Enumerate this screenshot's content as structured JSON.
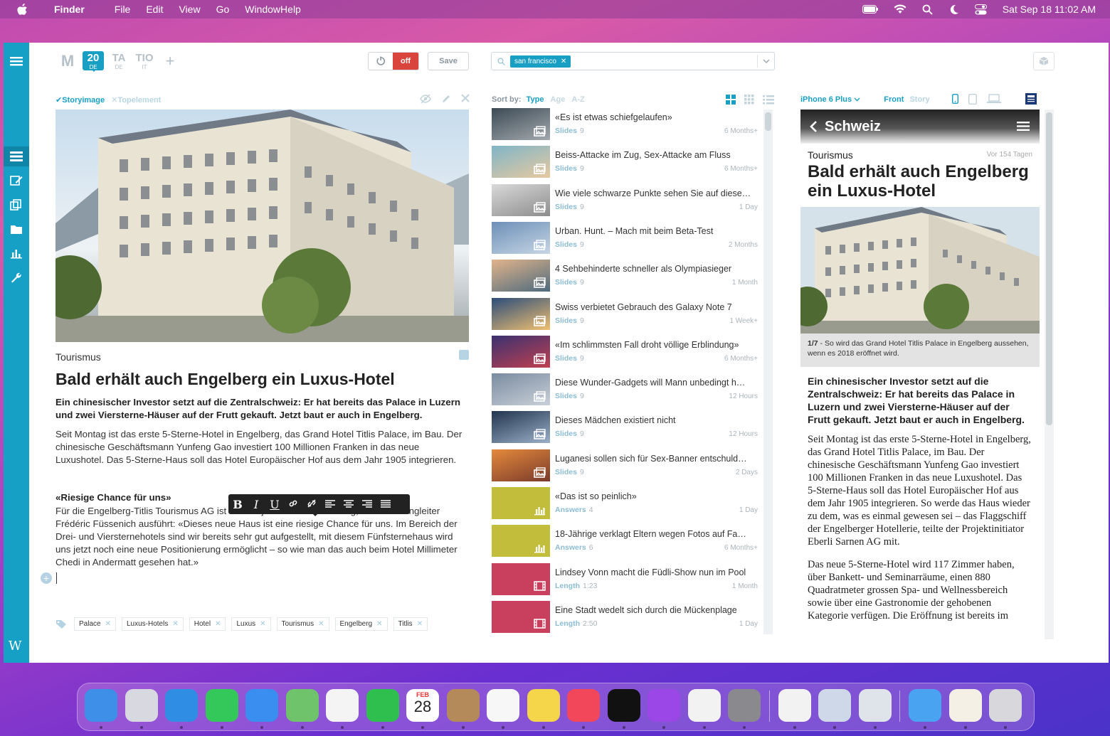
{
  "menubar": {
    "app": "Finder",
    "items": [
      "File",
      "Edit",
      "View",
      "Go",
      "WindowHelp"
    ],
    "clock": "Sat Sep 18  11:02 AM"
  },
  "toolbar": {
    "tabs": [
      {
        "top": "M",
        "bottom": ""
      },
      {
        "top": "20",
        "bottom": "DE"
      },
      {
        "top": "TA",
        "bottom": "DE"
      },
      {
        "top": "TIO",
        "bottom": "IT"
      },
      {
        "top": "+",
        "bottom": ""
      }
    ],
    "toggle_label": "off",
    "save_label": "Save",
    "search_chip": "san francisco"
  },
  "editor": {
    "tab_active": "Storyimage",
    "tab_inactive": "Topelement",
    "kicker": "Tourismus",
    "headline": "Bald erhält auch Engelberg ein Luxus-Hotel",
    "lead": "Ein chinesischer Investor setzt auf die Zentralschweiz: Er hat bereits das Palace in Luzern und zwei Viersterne-Häuser auf der Frutt gekauft. Jetzt baut er auch in Engelberg.",
    "body1": "Seit Montag ist das erste 5-Sterne-Hotel in Engelberg, das Grand Hotel Titlis Palace, im Bau. Der chinesische Geschäftsmann Yunfeng Gao investiert 100 Millionen Franken in das neue Luxushotel. Das 5-Sterne-Haus soll das Hotel Europäischer Hof aus dem Jahr 1905 integrieren.",
    "subhead": "«Riesige Chance für uns»",
    "body2": "Für die Engelberg-Titlis Tourismus AG ist das Projekt eine Bereicherung, wie Marketingleiter Frédéric Füssenich ausführt: «Dieses neue Haus ist eine riesige Chance für uns. Im Bereich der Drei- und Viersternehotels sind wir bereits sehr gut aufgestellt, mit diesem Fünfsternehaus wird uns jetzt noch eine neue Positionierung ermöglicht – so wie man das auch beim Hotel Millimeter Chedi in Andermatt gesehen hat.»",
    "format": {
      "bold": "B",
      "italic": "I",
      "underline": "U"
    },
    "tags": [
      "Palace",
      "Luxus-Hotels",
      "Hotel",
      "Luxus",
      "Tourismus",
      "Engelberg",
      "Titlis"
    ]
  },
  "list": {
    "sort_label": "Sort by:",
    "sort_options": [
      "Type",
      "Age",
      "A-Z"
    ],
    "items": [
      {
        "title": "«Es ist etwas schiefgelaufen»",
        "type": "Slides",
        "count": "9",
        "age": "6 Months+",
        "kind": "photo",
        "c1": "#3c4a55",
        "c2": "#a3a9ad"
      },
      {
        "title": "Beiss-Attacke im Zug, Sex-Attacke am Fluss",
        "type": "Slides",
        "count": "9",
        "age": "6 Months+",
        "kind": "photo",
        "c1": "#7fb5c8",
        "c2": "#e7c9a0"
      },
      {
        "title": "Wie viele schwarze Punkte sehen Sie auf diese…",
        "type": "Slides",
        "count": "9",
        "age": "1 Day",
        "kind": "photo",
        "c1": "#d9d9d9",
        "c2": "#8d8d8d"
      },
      {
        "title": "Urban. Hunt. – Mach mit beim Beta-Test",
        "type": "Slides",
        "count": "9",
        "age": "2 Months",
        "kind": "photo",
        "c1": "#6d8fb8",
        "c2": "#c6d6e4"
      },
      {
        "title": "4 Sehbehinderte schneller als Olympiasieger",
        "type": "Slides",
        "count": "9",
        "age": "1 Month",
        "kind": "photo",
        "c1": "#e2b48a",
        "c2": "#4d6a7e"
      },
      {
        "title": "Swiss verbietet Gebrauch des Galaxy Note 7",
        "type": "Slides",
        "count": "9",
        "age": "1 Week+",
        "kind": "photo",
        "c1": "#2b4c7a",
        "c2": "#f0c070"
      },
      {
        "title": "«Im schlimmsten Fall droht völlige Erblindung»",
        "type": "Slides",
        "count": "9",
        "age": "6 Months+",
        "kind": "photo",
        "c1": "#3a3170",
        "c2": "#c04050"
      },
      {
        "title": "Diese Wunder-Gadgets will Mann unbedingt h…",
        "type": "Slides",
        "count": "9",
        "age": "12 Hours",
        "kind": "photo",
        "c1": "#7a8ba0",
        "c2": "#c9d0d8"
      },
      {
        "title": "Dieses Mädchen existiert nicht",
        "type": "Slides",
        "count": "9",
        "age": "12 Hours",
        "kind": "photo",
        "c1": "#22344e",
        "c2": "#9bb0c8"
      },
      {
        "title": "Luganesi sollen sich für Sex-Banner entschuld…",
        "type": "Slides",
        "count": "9",
        "age": "2 Days",
        "kind": "photo",
        "c1": "#e58a3c",
        "c2": "#7a3a2a"
      },
      {
        "title": "«Das ist so peinlich»",
        "type": "Answers",
        "count": "4",
        "age": "1 Day",
        "kind": "chart",
        "c1": "#c3bd3c",
        "c2": "#c3bd3c"
      },
      {
        "title": "18-Jährige verklagt Eltern wegen Fotos auf Fa…",
        "type": "Answers",
        "count": "6",
        "age": "6 Months+",
        "kind": "chart",
        "c1": "#c3bd3c",
        "c2": "#c3bd3c"
      },
      {
        "title": "Lindsey Vonn macht die Füdli-Show nun im Pool",
        "type": "Length",
        "count": "1:23",
        "age": "1 Month",
        "kind": "video",
        "c1": "#c8405e",
        "c2": "#c8405e"
      },
      {
        "title": "Eine Stadt wedelt sich durch die Mückenplage",
        "type": "Length",
        "count": "2:50",
        "age": "1 Day",
        "kind": "video",
        "c1": "#c8405e",
        "c2": "#c8405e"
      }
    ]
  },
  "preview": {
    "device": "iPhone 6 Plus",
    "view_active": "Front",
    "view_inactive": "Story",
    "section": "Schweiz",
    "kicker": "Tourismus",
    "age": "Vor 154 Tagen",
    "title": "Bald erhält auch Engelberg ein Luxus-Hotel",
    "caption_num": "1/7",
    "caption": " - So wird das Grand Hotel Titlis Palace in Engelberg aussehen, wenn es 2018 eröffnet wird.",
    "lead": "Ein chinesischer Investor setzt auf die Zentralschweiz: Er hat bereits das Palace in Luzern und zwei Viersterne-Häuser auf der Frutt gekauft. Jetzt baut er auch in Engelberg.",
    "body1": "Seit Montag ist das erste 5-Sterne-Hotel in Engelberg, das Grand Hotel Titlis Palace, im Bau. Der chinesische Geschäftsmann Yunfeng Gao investiert 100 Millionen Franken in das neue Luxushotel. Das 5-Sterne-Haus soll das Hotel Europäischer Hof aus dem Jahr 1905 integrieren. So werde das Haus wieder zu dem, was es einmal gewesen sei – das Flaggschiff der Engelberger Hotellerie, teilte der Projektinitiator Eberli Sarnen AG mit.",
    "body2": "Das neue 5-Sterne-Hotel wird 117 Zimmer haben, über Bankett- und Seminarräume, einen 880 Quadratmeter grossen Spa- und Wellnessbereich sowie über eine Gastronomie der gehobenen Kategorie verfügen. Die Eröffnung ist bereits im"
  },
  "dock": {
    "calendar_month": "FEB",
    "calendar_day": "28",
    "apps": [
      {
        "name": "finder",
        "color": "#3d8fe8"
      },
      {
        "name": "launchpad",
        "color": "#d8d8e0"
      },
      {
        "name": "safari",
        "color": "#2f8de4"
      },
      {
        "name": "messages",
        "color": "#34c759"
      },
      {
        "name": "mail",
        "color": "#3a8ef0"
      },
      {
        "name": "maps",
        "color": "#6fc36a"
      },
      {
        "name": "photos",
        "color": "#f4f4f4"
      },
      {
        "name": "facetime",
        "color": "#2fbf4f"
      },
      {
        "name": "calendar",
        "color": "#ffffff"
      },
      {
        "name": "contacts",
        "color": "#b58a5a"
      },
      {
        "name": "reminders",
        "color": "#f7f7f7"
      },
      {
        "name": "notes",
        "color": "#f5d54a"
      },
      {
        "name": "music",
        "color": "#f2465b"
      },
      {
        "name": "tv",
        "color": "#111111"
      },
      {
        "name": "podcasts",
        "color": "#9b46e6"
      },
      {
        "name": "news",
        "color": "#f2f2f2"
      },
      {
        "name": "system-preferences",
        "color": "#8a8a8e"
      },
      {
        "name": "textedit",
        "color": "#f2f2f2"
      },
      {
        "name": "preview",
        "color": "#cfd8e8"
      },
      {
        "name": "blank-app",
        "color": "#dfe4ea"
      },
      {
        "name": "downloads-folder",
        "color": "#4aa3f0"
      },
      {
        "name": "document",
        "color": "#f4f0e6"
      },
      {
        "name": "trash",
        "color": "#d8d8dc"
      }
    ]
  }
}
